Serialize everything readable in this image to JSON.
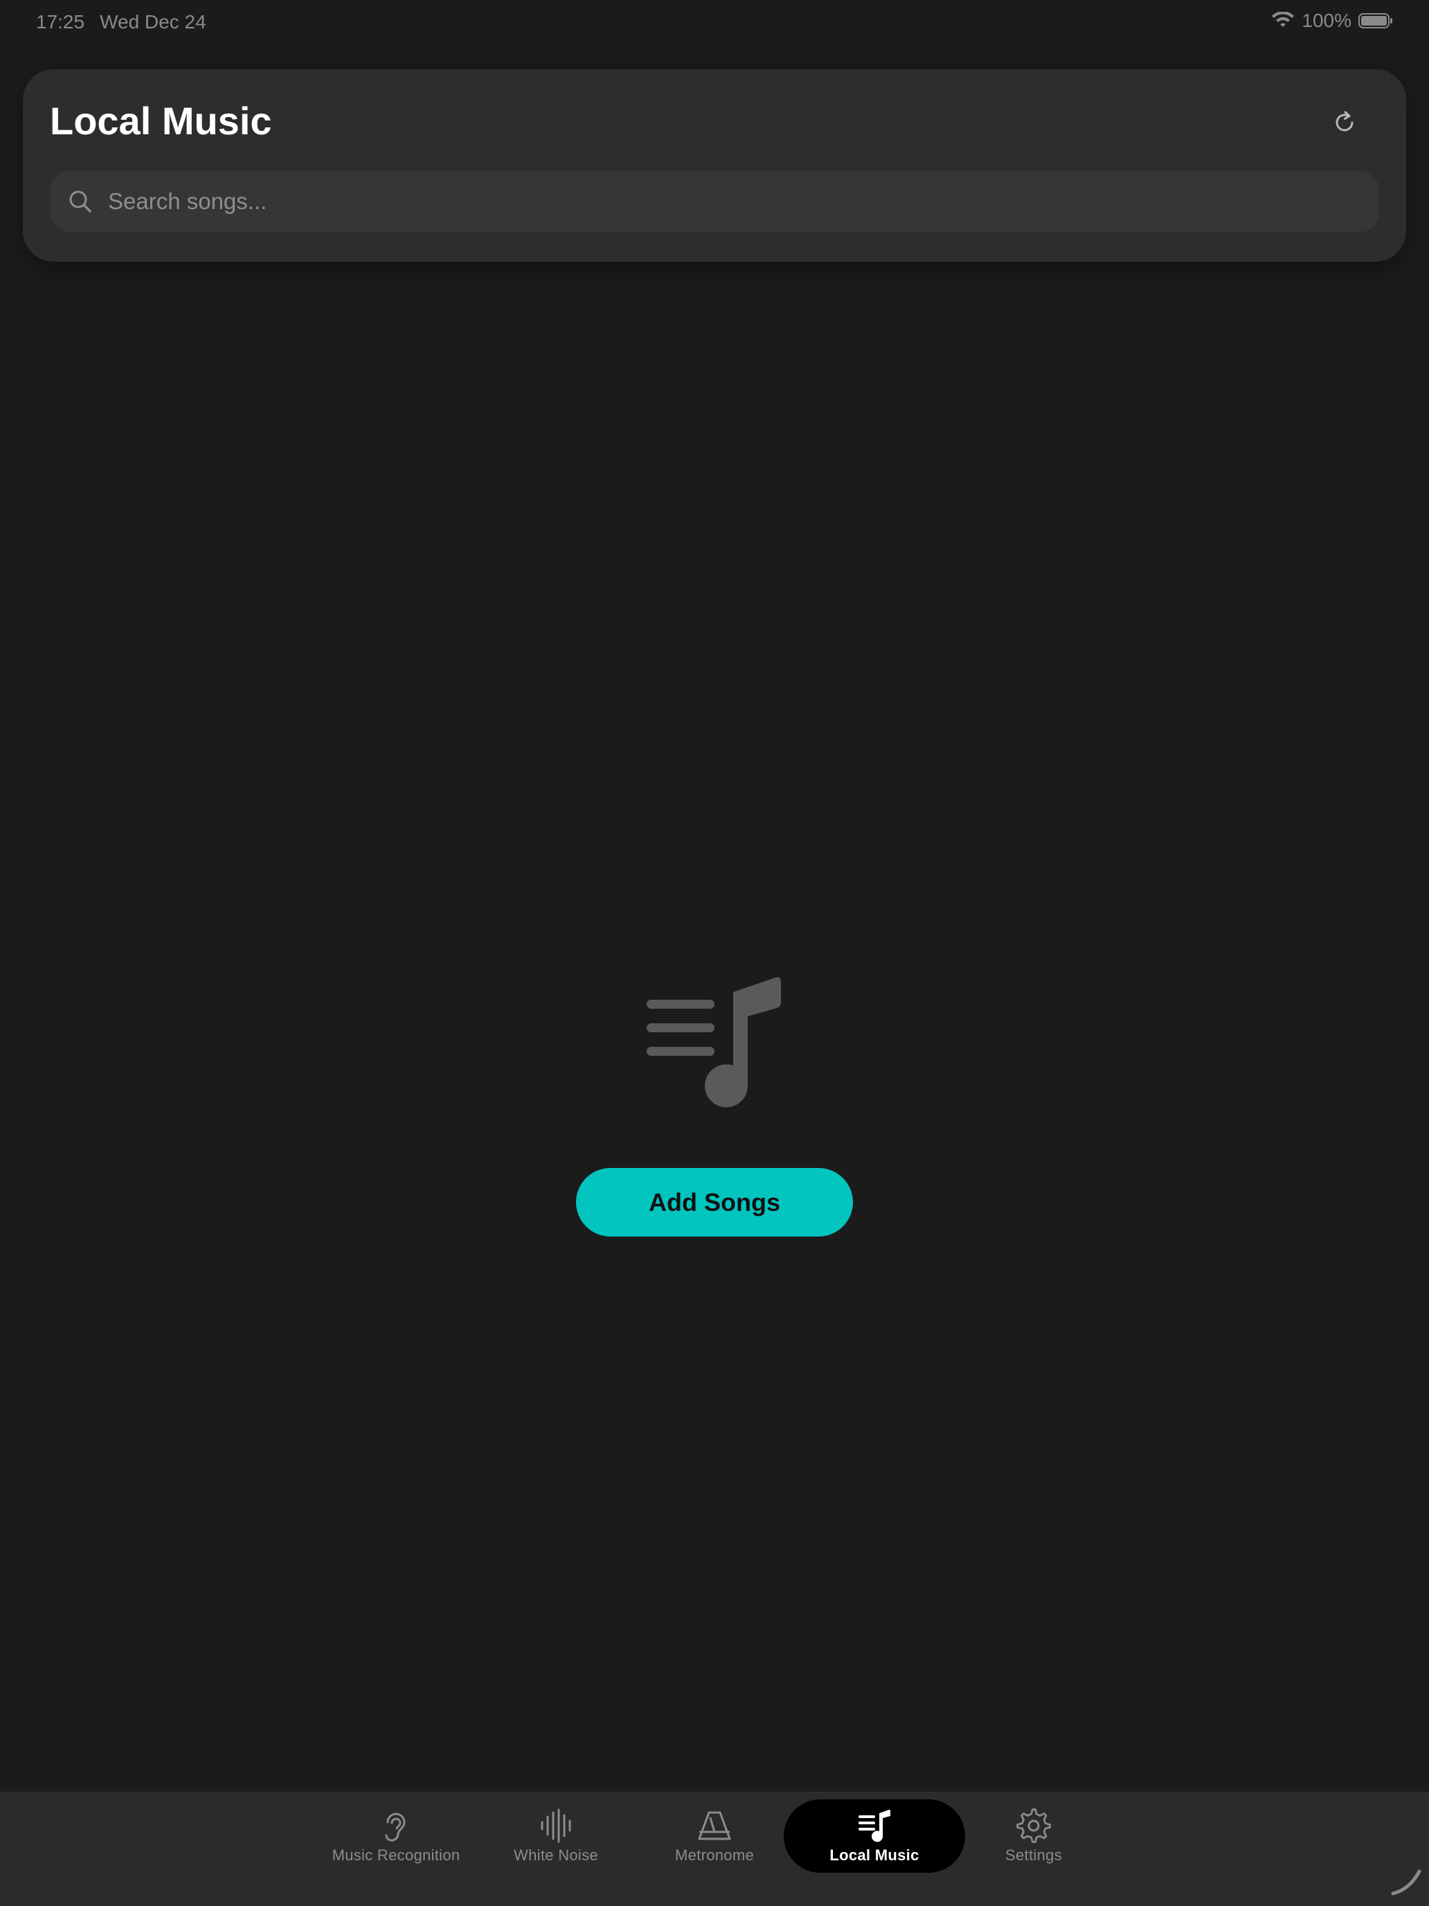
{
  "status_bar": {
    "time": "17:25",
    "date": "Wed Dec 24",
    "battery": "100%",
    "wifi_icon": "wifi-icon",
    "battery_icon": "battery-icon"
  },
  "header": {
    "title": "Local Music",
    "refresh_icon": "refresh-icon"
  },
  "search": {
    "placeholder": "Search songs...",
    "value": "",
    "icon": "search-icon"
  },
  "empty_state": {
    "icon": "music-list-icon",
    "button_label": "Add Songs"
  },
  "tabs": [
    {
      "label": "Music Recognition",
      "icon": "ear-icon",
      "active": false
    },
    {
      "label": "White Noise",
      "icon": "waveform-icon",
      "active": false
    },
    {
      "label": "Metronome",
      "icon": "metronome-icon",
      "active": false
    },
    {
      "label": "Local Music",
      "icon": "music-list-icon",
      "active": true
    },
    {
      "label": "Settings",
      "icon": "gear-icon",
      "active": false
    }
  ],
  "colors": {
    "background": "#1b1b1b",
    "card": "#2d2d2d",
    "accent": "#02c5bf",
    "tab_bar": "#2b2b2b",
    "active_tab": "#000000"
  }
}
